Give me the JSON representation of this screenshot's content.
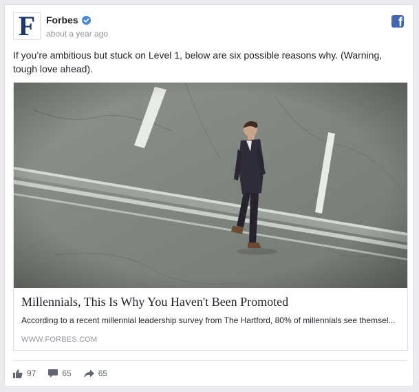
{
  "post": {
    "author": "Forbes",
    "logo_letter": "F",
    "time": "about a year ago",
    "message": "If you’re ambitious but stuck on Level 1, below are six possible reasons why. (Warning, tough love ahead).",
    "facebook_mark": "f"
  },
  "link": {
    "title": "Millennials, This Is Why You Haven't Been Promoted",
    "description": "According to a recent millennial leadership survey from The Hartford, 80% of millennials see themsel...",
    "domain": "WWW.FORBES.COM"
  },
  "stats": {
    "likes": "97",
    "comments": "65",
    "shares": "65"
  },
  "icons": {
    "verified": "verified-badge-icon",
    "facebook": "facebook-icon",
    "like": "thumbs-up-icon",
    "comment": "comment-bubble-icon",
    "share": "share-arrow-icon"
  },
  "colors": {
    "facebook_blue": "#4267b2",
    "verified_blue": "#4a89dc",
    "forbes_navy": "#1b3a6b",
    "muted_text": "#90949c"
  }
}
